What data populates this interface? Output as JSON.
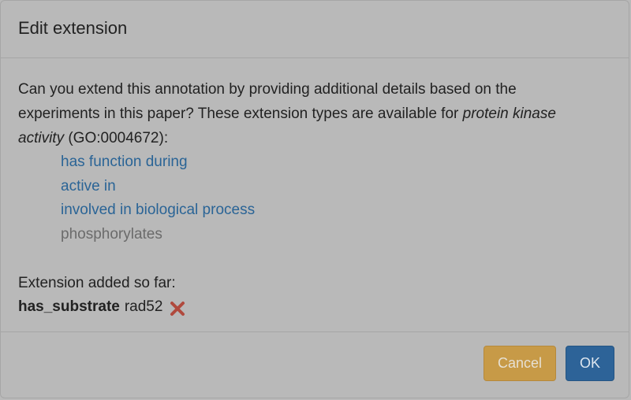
{
  "dialog": {
    "title": "Edit extension",
    "intro_text": "Can you extend this annotation by providing additional details based on the experiments in this paper? These extension types are available for ",
    "term_name": "protein kinase activity",
    "term_id_text": " (GO:0004672):",
    "extension_types": [
      {
        "label": "has function during",
        "enabled": true
      },
      {
        "label": "active in",
        "enabled": true
      },
      {
        "label": "involved in biological process",
        "enabled": true
      },
      {
        "label": "phosphorylates",
        "enabled": false
      }
    ],
    "added_heading": "Extension added so far:",
    "added_extension": {
      "relation": "has_substrate",
      "value": "rad52",
      "remove_icon": "remove-x-icon"
    },
    "buttons": {
      "cancel_label": "Cancel",
      "ok_label": "OK"
    }
  },
  "colors": {
    "overlay_background": "#b9b9b9",
    "link": "#2a6496",
    "disabled": "#6b6b6b",
    "cancel_button": "#c79a47",
    "ok_button": "#2d6398",
    "remove_icon": "#b04a3e"
  }
}
